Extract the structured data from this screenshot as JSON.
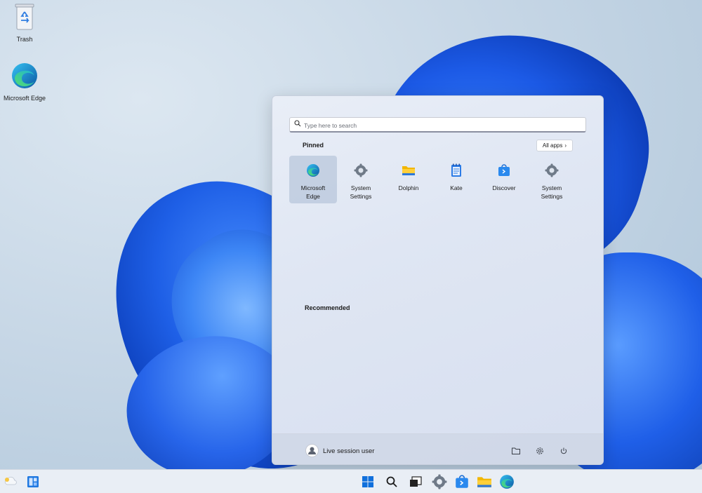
{
  "desktop": {
    "icons": [
      {
        "label": "Trash",
        "icon": "recycle-bin-icon"
      },
      {
        "label": "Microsoft Edge",
        "icon": "edge-icon"
      }
    ]
  },
  "start_menu": {
    "search": {
      "placeholder": "Type here to search",
      "icon": "search-icon"
    },
    "pinned_title": "Pinned",
    "all_apps_label": "All apps",
    "pinned_apps": [
      {
        "line1": "Microsoft",
        "line2": "Edge",
        "icon": "edge-icon"
      },
      {
        "line1": "System",
        "line2": "Settings",
        "icon": "gear-icon"
      },
      {
        "line1": "Dolphin",
        "line2": "",
        "icon": "folder-icon"
      },
      {
        "line1": "Kate",
        "line2": "",
        "icon": "notepad-icon"
      },
      {
        "line1": "Discover",
        "line2": "",
        "icon": "store-bag-icon"
      },
      {
        "line1": "System",
        "line2": "Settings",
        "icon": "gear-icon"
      }
    ],
    "recommended_title": "Recommended",
    "footer": {
      "user_name": "Live session user",
      "buttons": [
        "folder-icon",
        "gear-icon",
        "power-icon"
      ]
    }
  },
  "taskbar": {
    "left": [
      "weather-icon",
      "widgets-icon"
    ],
    "center": [
      "start-icon",
      "search-icon",
      "task-view-icon",
      "settings-icon",
      "store-icon",
      "file-explorer-icon",
      "edge-icon"
    ]
  },
  "colors": {
    "accent": "#0b5ed7",
    "menu_bg": "#e3e9f4",
    "taskbar_bg": "#e9eef5"
  }
}
